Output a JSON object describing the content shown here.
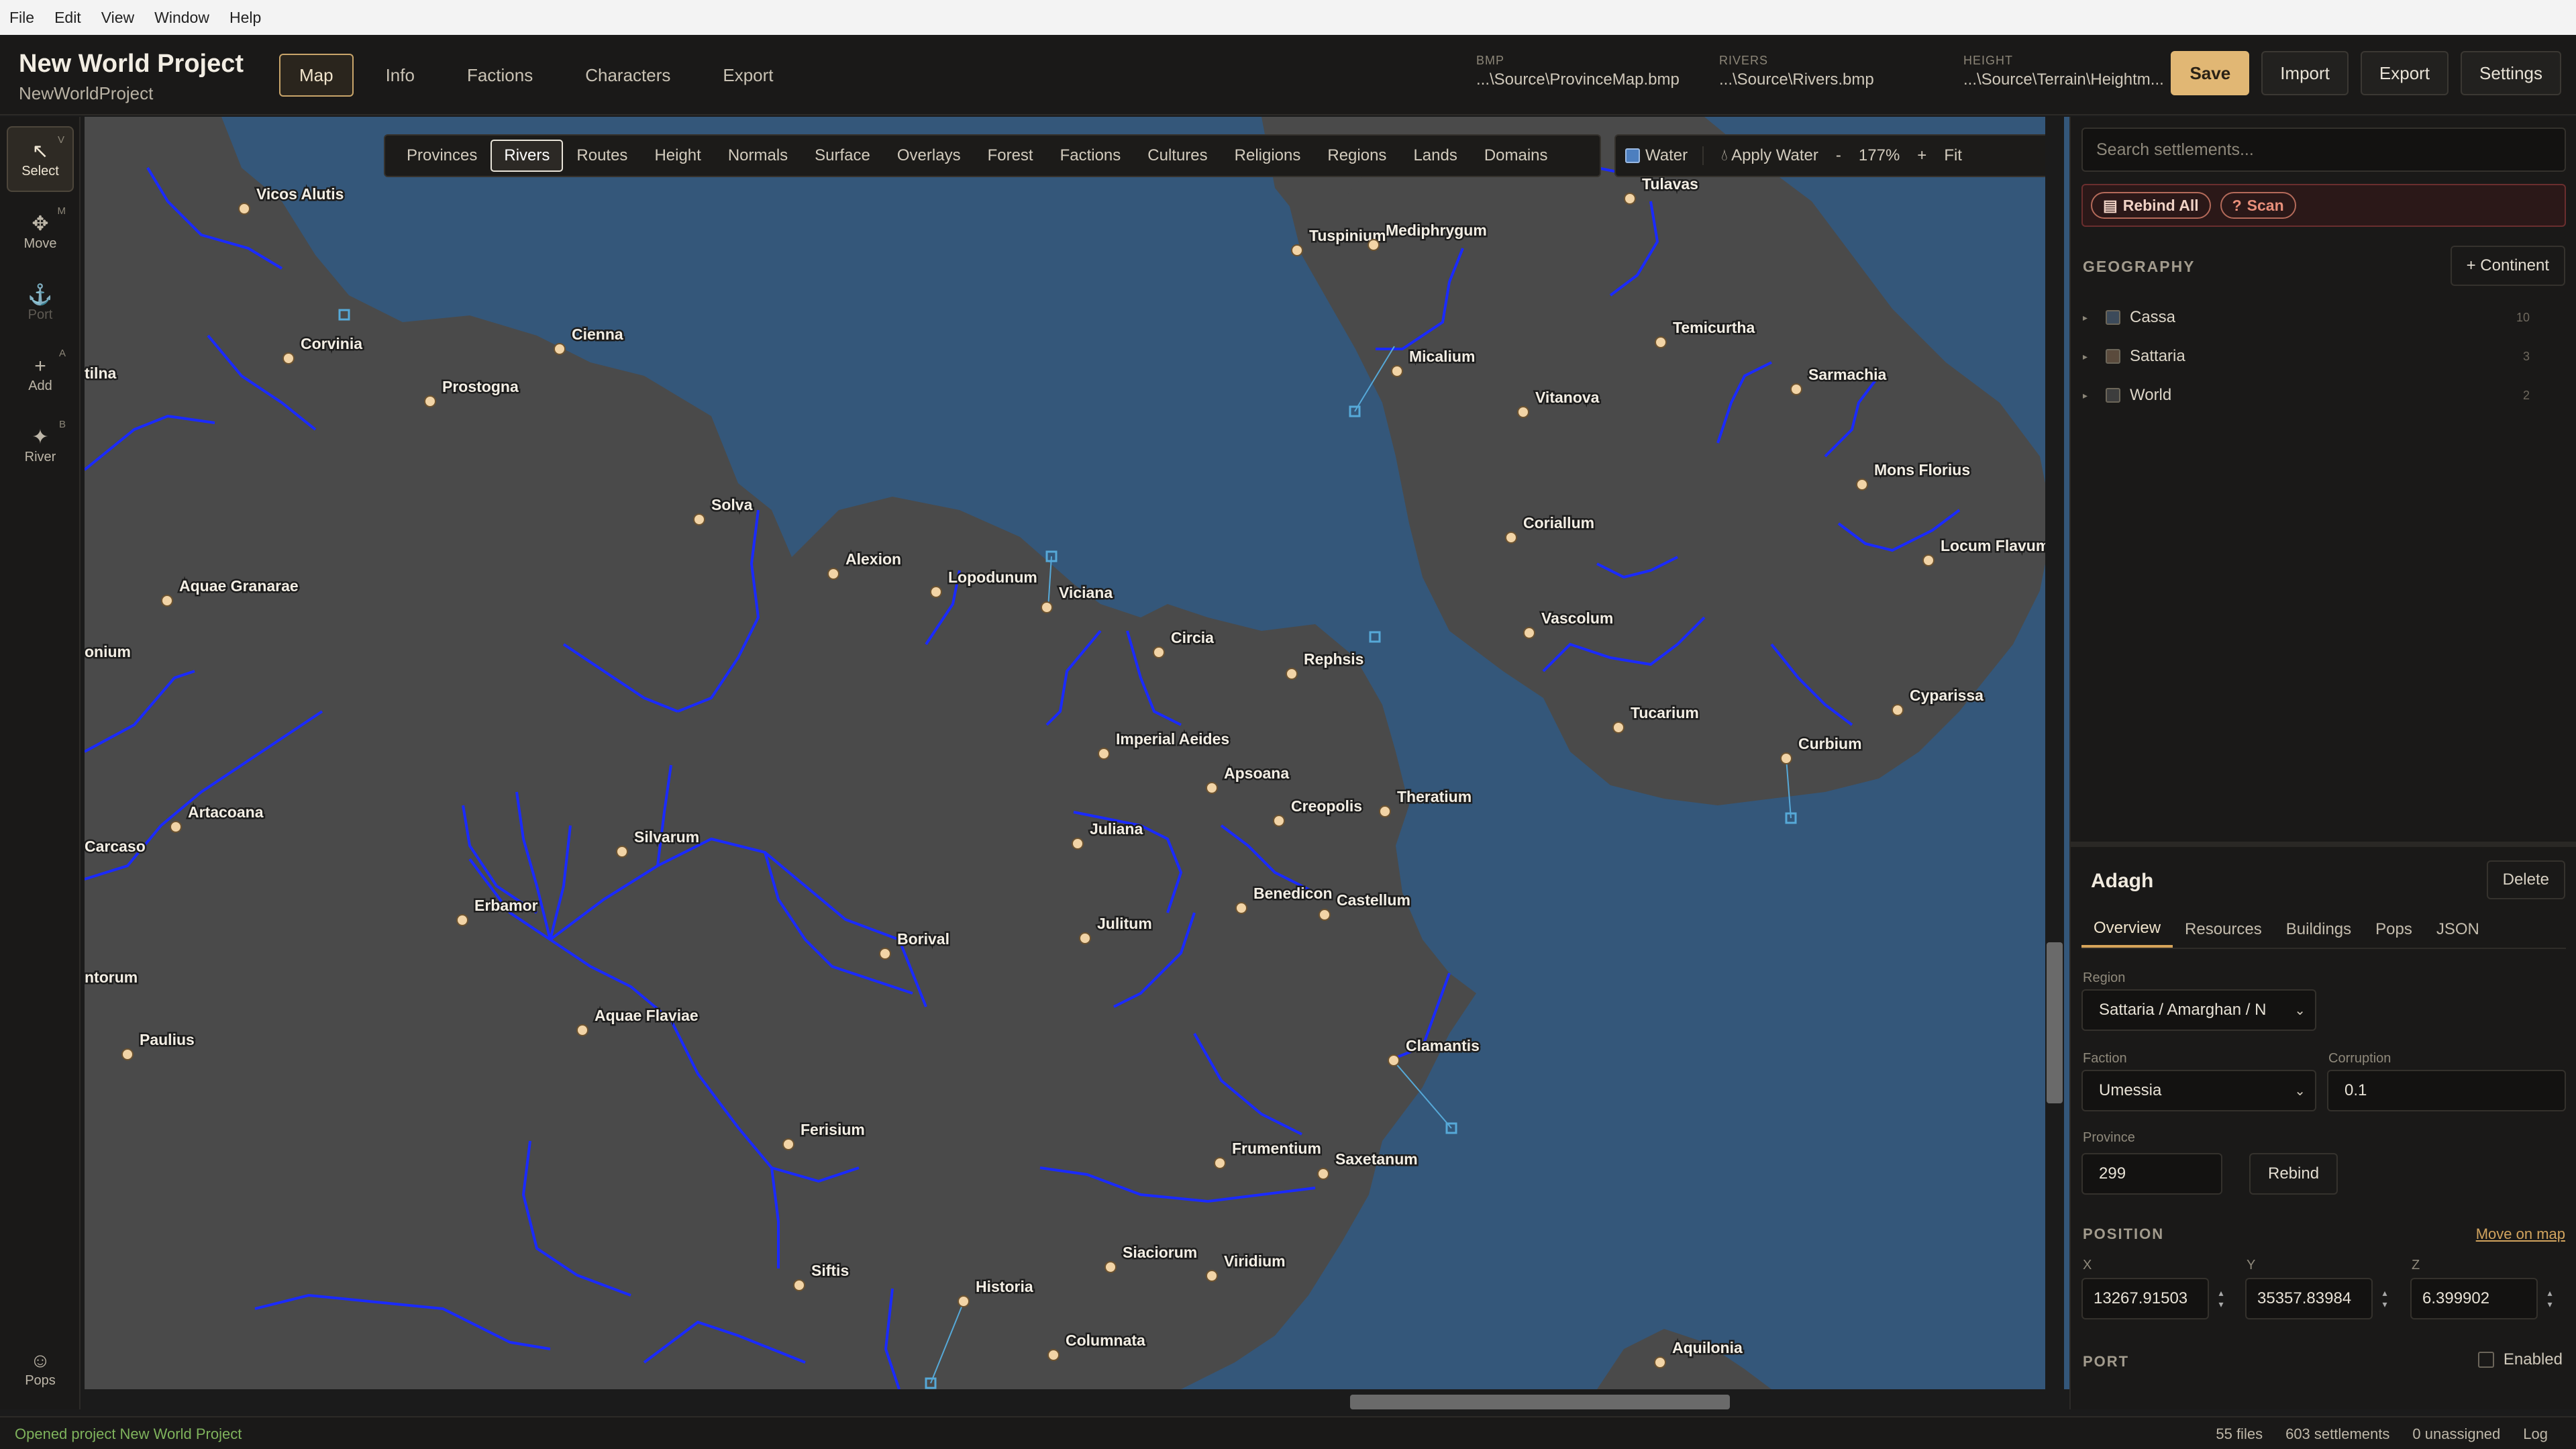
{
  "menu": [
    "File",
    "Edit",
    "Window",
    "Help",
    "View"
  ],
  "menu_items": {
    "file": "File",
    "edit": "Edit",
    "view": "View",
    "window": "Window",
    "help": "Help"
  },
  "project": {
    "title": "New World Project",
    "subtitle": "NewWorldProject"
  },
  "nav": {
    "map": "Map",
    "info": "Info",
    "factions": "Factions",
    "characters": "Characters",
    "export": "Export"
  },
  "sources": {
    "bmp_label": "BMP",
    "bmp_path": "...\\Source\\ProvinceMap.bmp",
    "rivers_label": "RIVERS",
    "rivers_path": "...\\Source\\Rivers.bmp",
    "height_label": "HEIGHT",
    "height_path": "...\\Source\\Terrain\\Heightm..."
  },
  "actions": {
    "save": "Save",
    "import": "Import",
    "export": "Export",
    "settings": "Settings"
  },
  "tools": {
    "select": "Select",
    "select_key": "V",
    "move": "Move",
    "move_key": "M",
    "port": "Port",
    "add": "Add",
    "add_key": "A",
    "river": "River",
    "river_key": "B",
    "pops": "Pops"
  },
  "layers": [
    "Provinces",
    "Rivers",
    "Routes",
    "Height",
    "Normals",
    "Surface",
    "Overlays",
    "Forest",
    "Factions",
    "Cultures",
    "Religions",
    "Regions",
    "Lands",
    "Domains"
  ],
  "active_layer": "Rivers",
  "map_controls": {
    "water": "Water",
    "apply_water": "Apply Water",
    "minus": "-",
    "zoom": "177%",
    "plus": "+",
    "fit": "Fit"
  },
  "colors": {
    "water": "#34577a",
    "land": "#4a4a4a",
    "river": "#1a2aff",
    "accent": "#e1b774",
    "settlement": "#f2d4a6",
    "waypoint": "#56a9d8"
  },
  "settlements": [
    "Vicos Alutis",
    "Corvinia",
    "Cienna",
    "Prostogna",
    "tilna",
    "Aquae Granarae",
    "Solva",
    "Alexion",
    "Lopodunum",
    "Viciana",
    "onium",
    "Circia",
    "Rephsis",
    "Imperial Aeides",
    "Apsoana",
    "Artacoana",
    "Carcaso",
    "Silvarum",
    "Juliana",
    "Creopolis",
    "Theratium",
    "Benedicon",
    "Castellum",
    "Erbamor",
    "Julitum",
    "Borival",
    "ntorum",
    "Paulius",
    "Aquae Flaviae",
    "Clamantis",
    "Ferisium",
    "Frumentium",
    "Saxetanum",
    "Siftis",
    "Historia",
    "Siaciorum",
    "Viridium",
    "Columnata",
    "Tuspinium",
    "Mediphrygum",
    "Tulavas",
    "Micalium",
    "Temicurtha",
    "Vitanova",
    "Sarmachia",
    "Mons Florius",
    "Coriallum",
    "Locum Flavum",
    "Vascolum",
    "Cyparissa",
    "Tucarium",
    "Curbium",
    "Aquilonia"
  ],
  "panel": {
    "search_placeholder": "Search settlements...",
    "rebind_all": "Rebind All",
    "scan": "Scan",
    "geography_heading": "GEOGRAPHY",
    "add_continent": "+ Continent",
    "geography": [
      {
        "name": "Cassa",
        "count": "10",
        "color": "#3c4a5a"
      },
      {
        "name": "Sattaria",
        "count": "3",
        "color": "#5a4a3c"
      },
      {
        "name": "World",
        "count": "2",
        "color": "#3d3d3d"
      }
    ],
    "selected": {
      "name": "Adagh",
      "delete": "Delete",
      "tabs": [
        "Overview",
        "Resources",
        "Buildings",
        "Pops",
        "JSON"
      ],
      "region_label": "Region",
      "region_value": "Sattaria / Amarghan / N",
      "faction_label": "Faction",
      "faction_value": "Umessia",
      "corruption_label": "Corruption",
      "corruption_value": "0.1",
      "province_label": "Province",
      "province_value": "299",
      "rebind": "Rebind",
      "position_heading": "POSITION",
      "move_on_map": "Move on map",
      "x_label": "X",
      "x_value": "13267.91503",
      "y_label": "Y",
      "y_value": "35357.83984",
      "z_label": "Z",
      "z_value": "6.399902",
      "port_heading": "PORT",
      "port_enabled": "Enabled"
    }
  },
  "status": {
    "message": "Opened project New World Project",
    "files": "55 files",
    "settlements": "603 settlements",
    "unassigned": "0 unassigned",
    "log": "Log"
  }
}
